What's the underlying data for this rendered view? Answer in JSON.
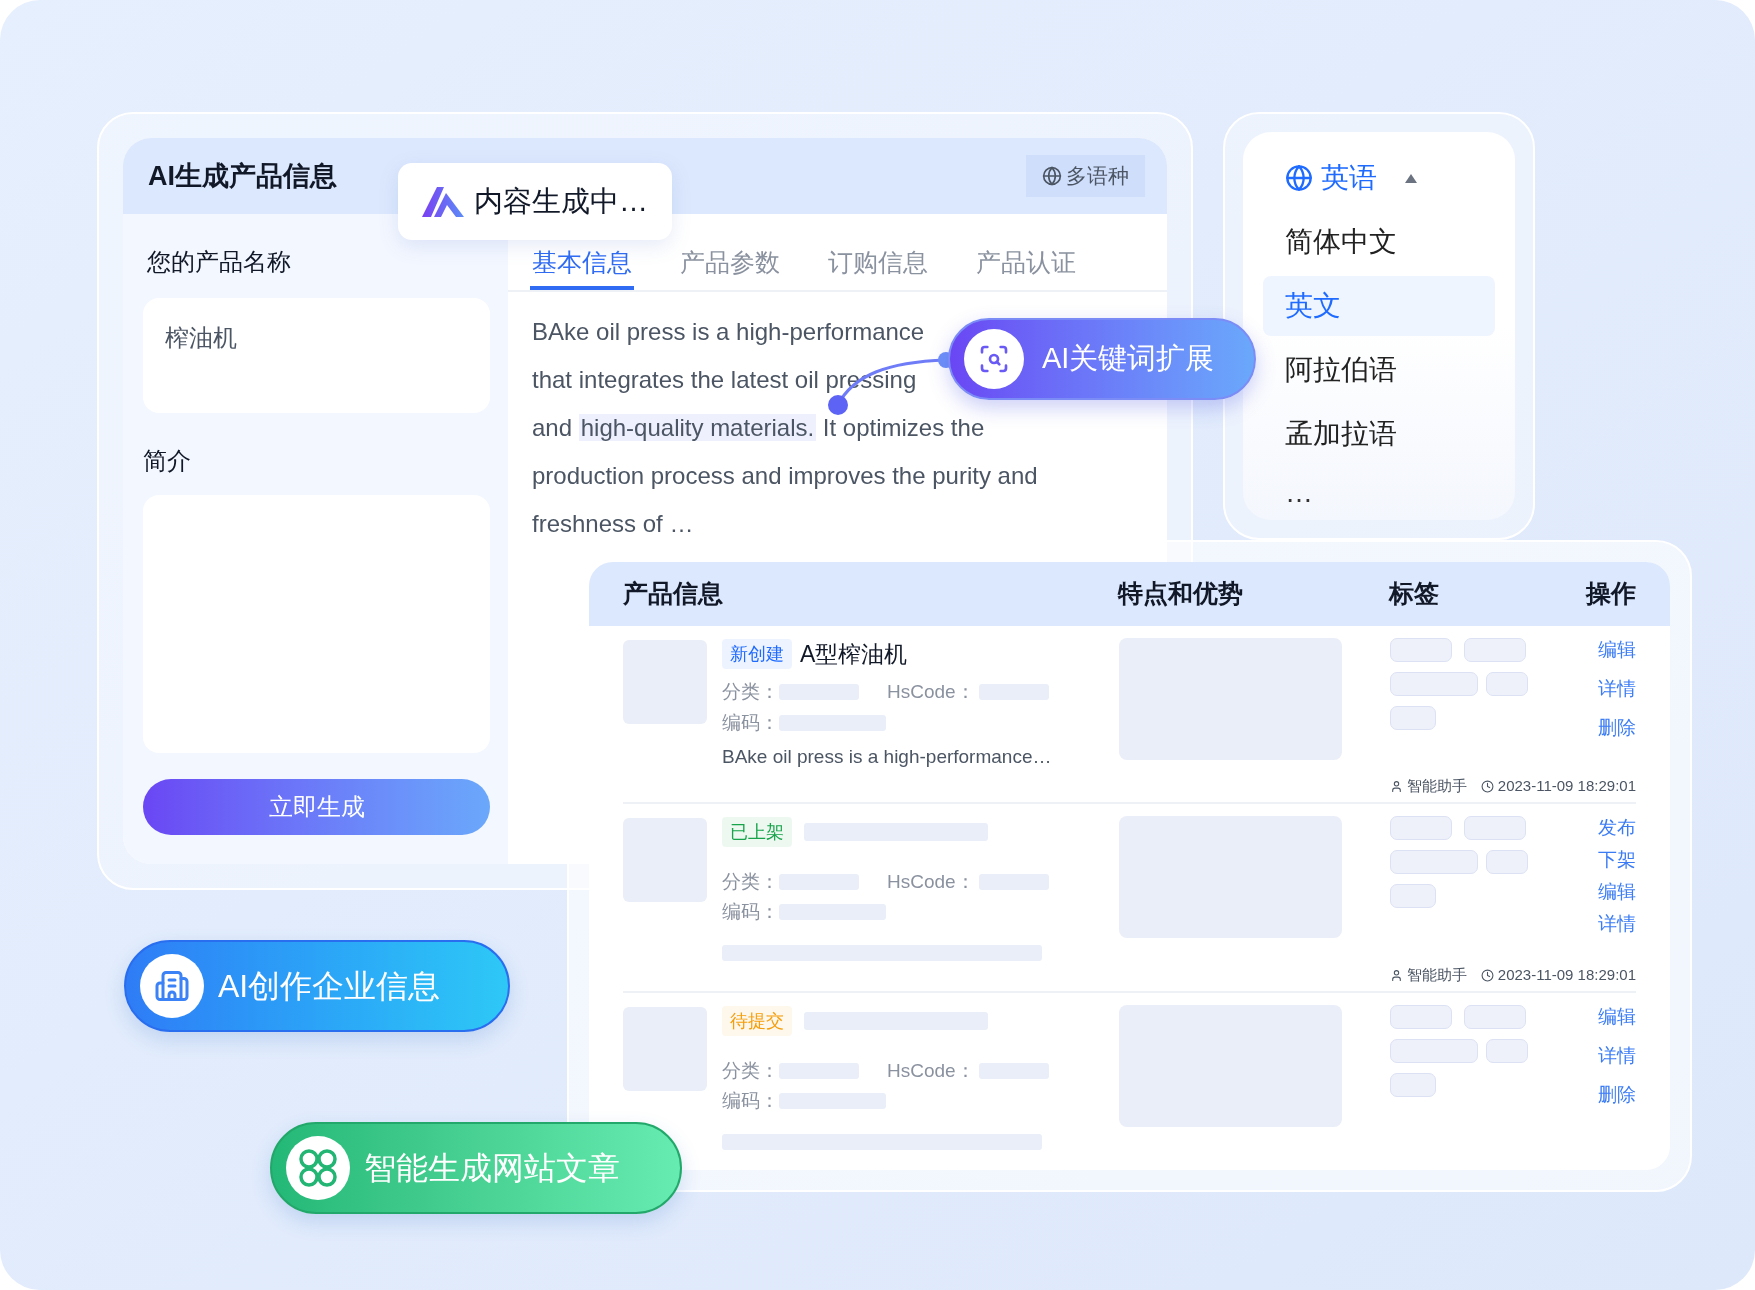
{
  "main_panel": {
    "title": "AI生成产品信息",
    "language_button": "多语种",
    "name_label": "您的产品名称",
    "name_value": "榨油机",
    "intro_label": "简介",
    "generate_button": "立即生成",
    "tabs": [
      {
        "label": "基本信息",
        "selected": true
      },
      {
        "label": "产品参数",
        "selected": false
      },
      {
        "label": "订购信息",
        "selected": false
      },
      {
        "label": "产品认证",
        "selected": false
      }
    ],
    "description_lines": [
      {
        "text": "BAke oil press is a high-performance"
      },
      {
        "text": "that integrates the latest oil pressing"
      },
      {
        "text": "and ",
        "highlight": "high-quality materials.",
        "after": " It optimizes the"
      },
      {
        "text": "production process and improves the purity and"
      },
      {
        "text": "freshness of …"
      }
    ]
  },
  "status_popup": {
    "text": "内容生成中…"
  },
  "keyword_badge": {
    "text": "AI关键词扩展"
  },
  "language_menu": {
    "current": "英语",
    "expanded": true,
    "options": [
      {
        "label": "简体中文",
        "selected": false
      },
      {
        "label": "英文",
        "selected": true
      },
      {
        "label": "阿拉伯语",
        "selected": false
      },
      {
        "label": "孟加拉语",
        "selected": false
      }
    ],
    "more": "…"
  },
  "table": {
    "columns": [
      "产品信息",
      "特点和优势",
      "标签",
      "操作"
    ],
    "rows": [
      {
        "status": "新创建",
        "color": "#1f6bff",
        "name": "A型榨油机",
        "category_label": "分类：",
        "hscode_label": "HsCode：",
        "code_label": "编码：",
        "summary": "BAke oil press is a high-performance…",
        "actions": [
          "编辑",
          "详情",
          "删除"
        ],
        "author": "智能助手",
        "time": "2023-11-09 18:29:01"
      },
      {
        "status": "已上架",
        "color": "#16a34a",
        "category_label": "分类：",
        "hscode_label": "HsCode：",
        "code_label": "编码：",
        "actions": [
          "发布",
          "下架",
          "编辑",
          "详情"
        ],
        "author": "智能助手",
        "time": "2023-11-09 18:29:01"
      },
      {
        "status": "待提交",
        "color": "#f59e0b",
        "category_label": "分类：",
        "hscode_label": "HsCode：",
        "code_label": "编码：",
        "actions": [
          "编辑",
          "详情",
          "删除"
        ]
      }
    ]
  },
  "feature_pills": [
    {
      "kind": "building",
      "text": "AI创作企业信息"
    },
    {
      "kind": "clover",
      "text": "智能生成网站文章"
    }
  ]
}
